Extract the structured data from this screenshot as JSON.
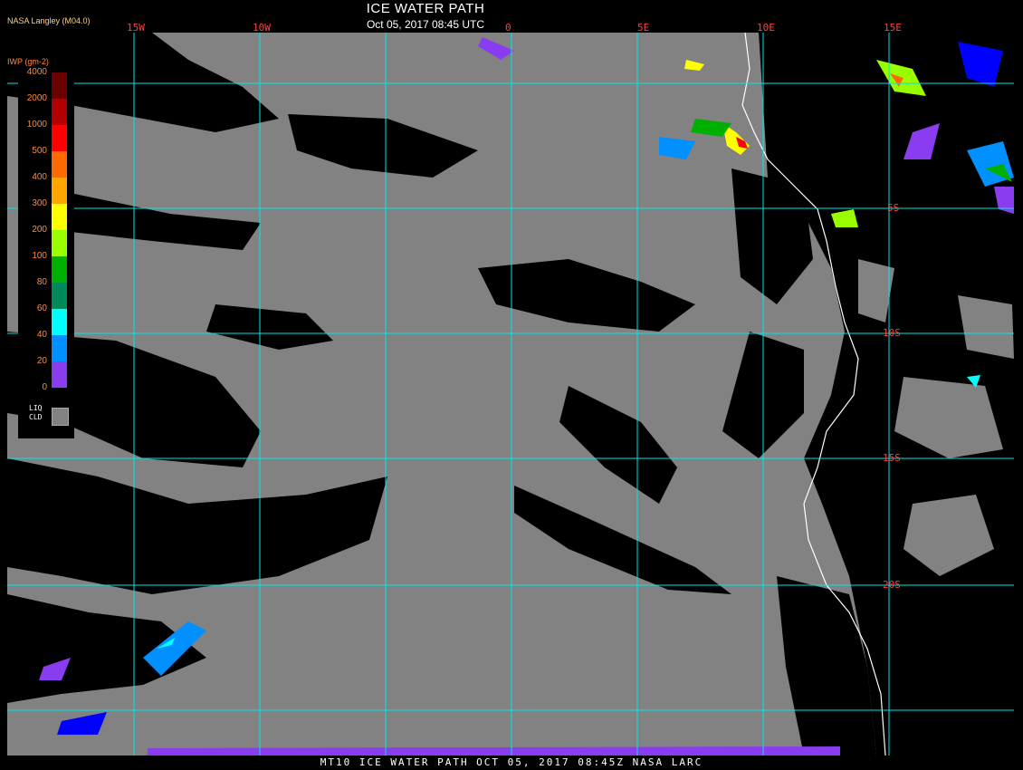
{
  "header": {
    "title": "ICE WATER PATH",
    "subtitle": "Oct 05, 2017 08:45 UTC",
    "credit": "NASA Langley (M04.0)"
  },
  "legend": {
    "title": "IWP (gm-2)",
    "levels": [
      {
        "label": "4000",
        "color": "#6b0000"
      },
      {
        "label": "2000",
        "color": "#b00000"
      },
      {
        "label": "1000",
        "color": "#ff0000"
      },
      {
        "label": "500",
        "color": "#ff6a00"
      },
      {
        "label": "400",
        "color": "#ffa500"
      },
      {
        "label": "300",
        "color": "#ffff00"
      },
      {
        "label": "200",
        "color": "#99ff00"
      },
      {
        "label": "100",
        "color": "#00b000"
      },
      {
        "label": "80",
        "color": "#008a5a"
      },
      {
        "label": "60",
        "color": "#00ffff"
      },
      {
        "label": "40",
        "color": "#0090ff"
      },
      {
        "label": "20",
        "color": "#0000ff"
      },
      {
        "label": "0",
        "color": "#8a3cf0"
      }
    ],
    "liq_label_1": "LIQ",
    "liq_label_2": "CLD",
    "liq_color": "#828282"
  },
  "grid": {
    "lon_labels": [
      "15W",
      "10W",
      "0",
      "5E",
      "10E",
      "15E"
    ],
    "lat_labels": [
      "5S",
      "10S",
      "15S",
      "20S"
    ],
    "line_color": "#00e5e5"
  },
  "footer": "MT10  ICE WATER PATH  OCT 05, 2017 08:45Z  NASA LARC"
}
